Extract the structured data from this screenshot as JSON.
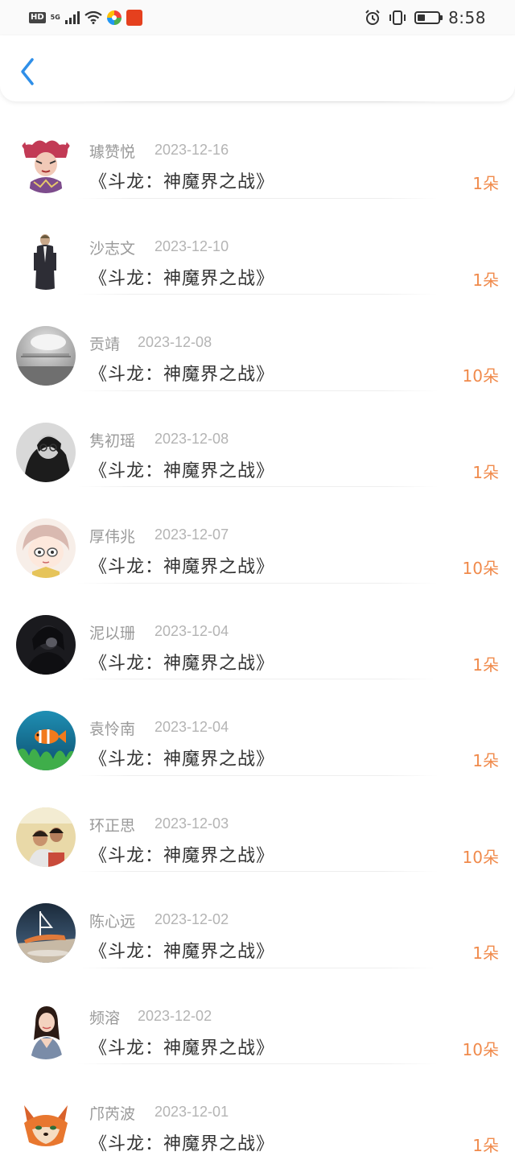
{
  "status_bar": {
    "network_badge": "HD",
    "network_type": "5G",
    "time": "8:58",
    "icons": [
      "hd-icon",
      "signal-icon",
      "wifi-icon",
      "app-icon",
      "app-icon",
      "alarm-icon",
      "vibrate-icon",
      "battery-icon"
    ]
  },
  "header": {
    "back_icon": "chevron-left-icon"
  },
  "colors": {
    "accent": "#2f8fe8",
    "amount": "#f08a4b",
    "name": "#9a9a9a",
    "date": "#b4b4b4",
    "title": "#333333"
  },
  "records": [
    {
      "name": "璩赞悦",
      "date": "2023-12-16",
      "title": "《斗龙：神魔界之战》",
      "amount": "1朵"
    },
    {
      "name": "沙志文",
      "date": "2023-12-10",
      "title": "《斗龙：神魔界之战》",
      "amount": "1朵"
    },
    {
      "name": "贡靖",
      "date": "2023-12-08",
      "title": "《斗龙：神魔界之战》",
      "amount": "10朵"
    },
    {
      "name": "隽初瑶",
      "date": "2023-12-08",
      "title": "《斗龙：神魔界之战》",
      "amount": "1朵"
    },
    {
      "name": "厚伟兆",
      "date": "2023-12-07",
      "title": "《斗龙：神魔界之战》",
      "amount": "10朵"
    },
    {
      "name": "泥以珊",
      "date": "2023-12-04",
      "title": "《斗龙：神魔界之战》",
      "amount": "1朵"
    },
    {
      "name": "袁怜南",
      "date": "2023-12-04",
      "title": "《斗龙：神魔界之战》",
      "amount": "1朵"
    },
    {
      "name": "环正思",
      "date": "2023-12-03",
      "title": "《斗龙：神魔界之战》",
      "amount": "10朵"
    },
    {
      "name": "陈心远",
      "date": "2023-12-02",
      "title": "《斗龙：神魔界之战》",
      "amount": "1朵"
    },
    {
      "name": "频溶",
      "date": "2023-12-02",
      "title": "《斗龙：神魔界之战》",
      "amount": "10朵"
    },
    {
      "name": "邝芮波",
      "date": "2023-12-01",
      "title": "《斗龙：神魔界之战》",
      "amount": "1朵"
    }
  ]
}
